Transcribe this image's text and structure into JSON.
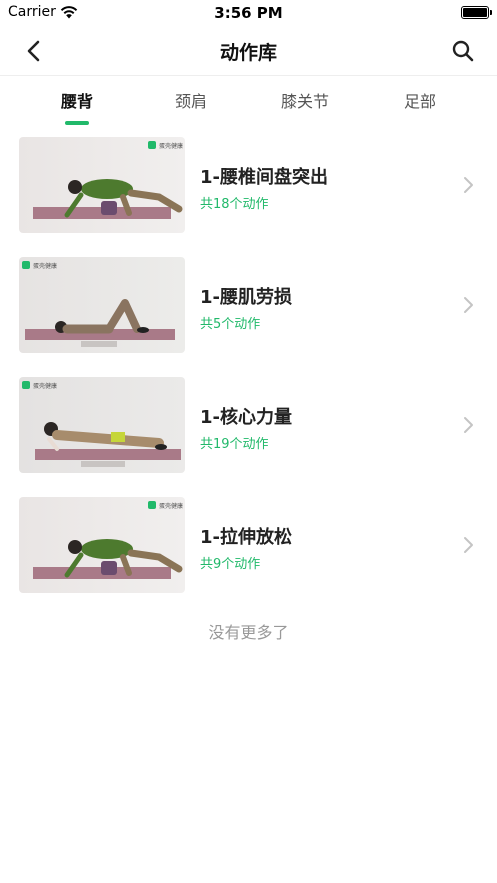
{
  "status_bar": {
    "carrier": "Carrier",
    "time": "3:56 PM"
  },
  "nav": {
    "title": "动作库"
  },
  "tabs": [
    {
      "label": "腰背",
      "active": true
    },
    {
      "label": "颈肩",
      "active": false
    },
    {
      "label": "膝关节",
      "active": false
    },
    {
      "label": "足部",
      "active": false
    }
  ],
  "items": [
    {
      "title": "1-腰椎间盘突出",
      "count": "共18个动作",
      "logo_text": "蛋壳健康"
    },
    {
      "title": "1-腰肌劳损",
      "count": "共5个动作",
      "logo_text": "蛋壳健康"
    },
    {
      "title": "1-核心力量",
      "count": "共19个动作",
      "logo_text": "蛋壳健康"
    },
    {
      "title": "1-拉伸放松",
      "count": "共9个动作",
      "logo_text": "蛋壳健康"
    }
  ],
  "footer": {
    "end_text": "没有更多了"
  },
  "colors": {
    "accent": "#21b96a",
    "text": "#222222",
    "muted": "#999999"
  }
}
